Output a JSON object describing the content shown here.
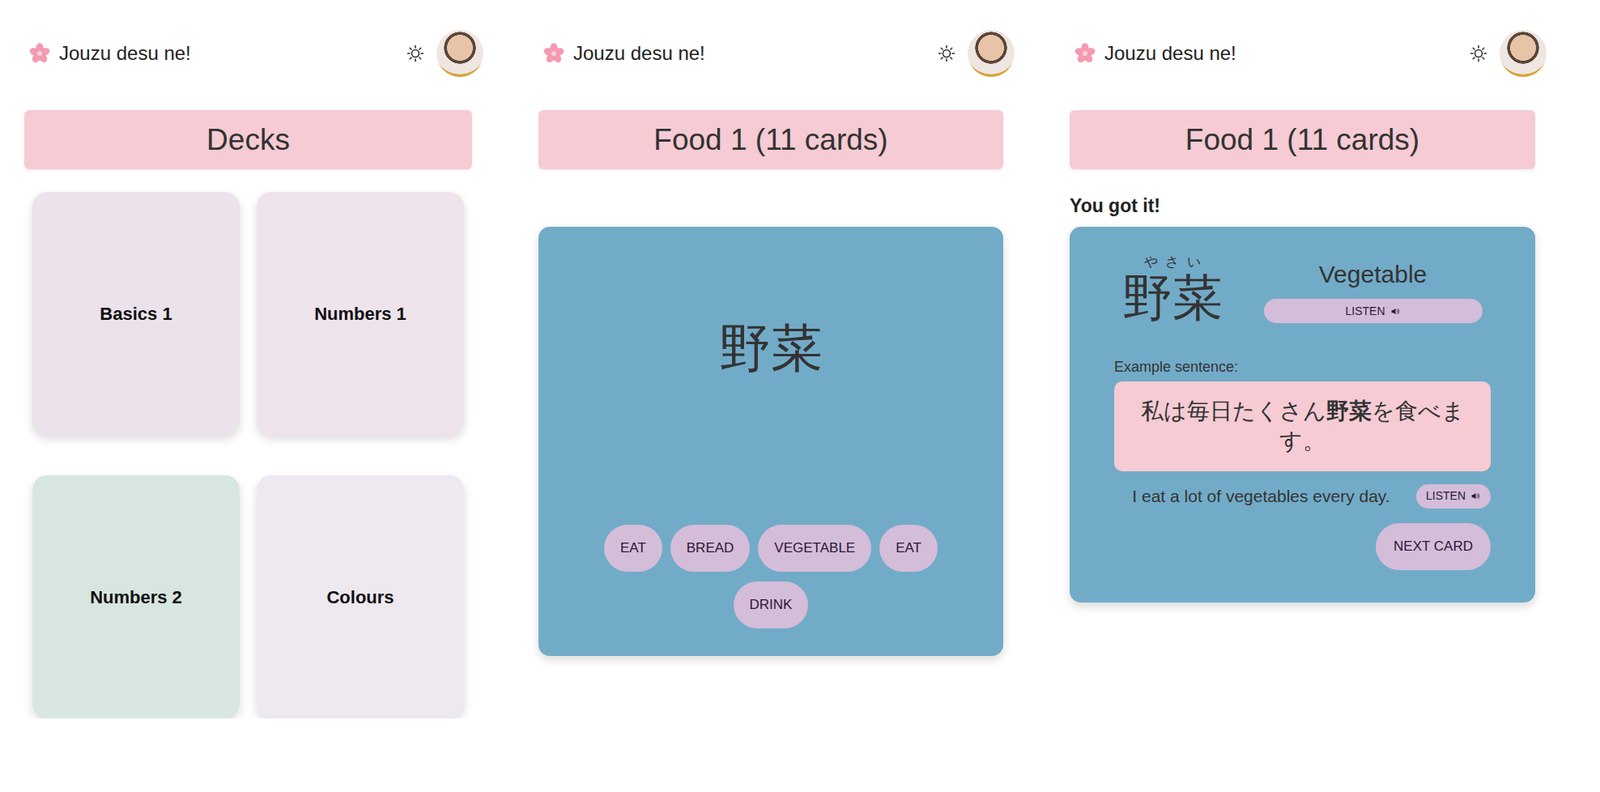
{
  "screens": [
    {
      "kind": "decks",
      "header": {
        "title": "Jouzu desu ne!"
      },
      "banner": "Decks",
      "decks": [
        {
          "name": "Basics 1",
          "color": "#ebe2ec"
        },
        {
          "name": "Numbers 1",
          "color": "#efe3ec"
        },
        {
          "name": "Numbers 2",
          "color": "#d8e6e0"
        },
        {
          "name": "Colours",
          "color": "#eee8f0"
        }
      ]
    },
    {
      "kind": "question",
      "header": {
        "title": "Jouzu desu ne!"
      },
      "banner": "Food 1 (11 cards)",
      "card": {
        "word": "野菜",
        "options": [
          "EAT",
          "BREAD",
          "VEGETABLE",
          "EAT",
          "DRINK"
        ]
      }
    },
    {
      "kind": "answer",
      "header": {
        "title": "Jouzu desu ne!"
      },
      "banner": "Food 1 (11 cards)",
      "feedback": "You got it!",
      "card": {
        "reading": "やさい",
        "word": "野菜",
        "meaning": "Vegetable",
        "listen": "LISTEN",
        "example_label": "Example sentence:",
        "example": {
          "before": "私は毎日たくさん",
          "highlight": "野菜",
          "after": "を食べます。"
        },
        "translation": "I eat a lot of vegetables every day.",
        "translation_listen": "LISTEN",
        "next": "NEXT CARD"
      }
    }
  ]
}
